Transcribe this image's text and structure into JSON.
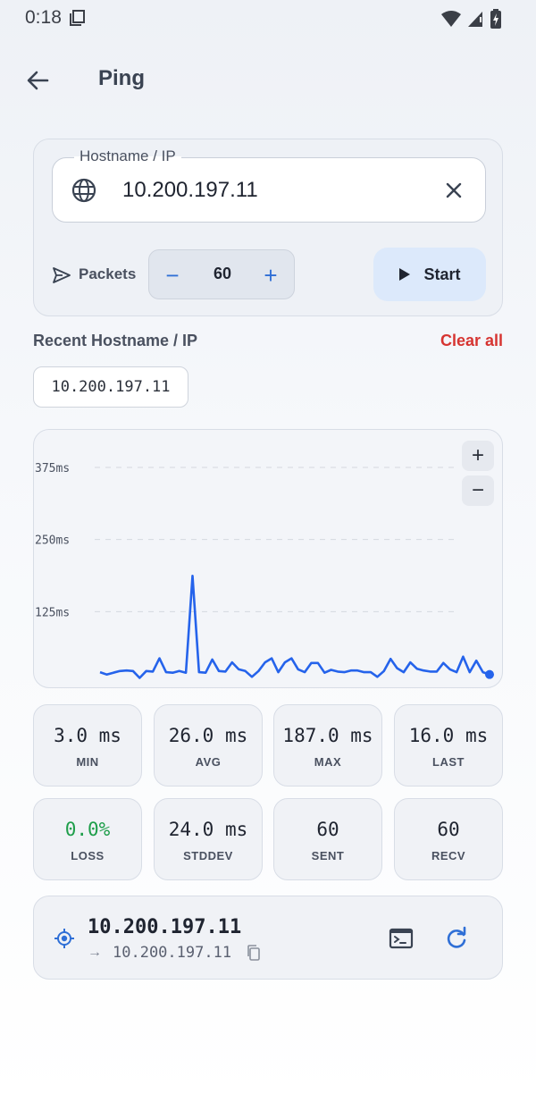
{
  "status_bar": {
    "time": "0:18"
  },
  "app_bar": {
    "title": "Ping"
  },
  "input": {
    "label": "Hostname / IP",
    "value": "10.200.197.11",
    "packets_label": "Packets",
    "packets_value": "60",
    "minus": "−",
    "plus": "+",
    "start_label": "Start"
  },
  "recent": {
    "title": "Recent Hostname / IP",
    "clear_all": "Clear all",
    "items": [
      "10.200.197.11"
    ]
  },
  "chart_data": {
    "type": "line",
    "y_tick_labels": [
      "375ms",
      "250ms",
      "125ms"
    ],
    "y_ticks": [
      375,
      250,
      125
    ],
    "ylim": [
      0,
      440
    ],
    "grid": "horizontal dashed",
    "x_range": [
      1,
      60
    ],
    "series": [
      {
        "color": "#2563eb",
        "values": [
          20,
          16,
          19,
          22,
          23,
          22,
          10,
          22,
          21,
          44,
          20,
          19,
          22,
          19,
          187,
          20,
          19,
          42,
          22,
          21,
          37,
          25,
          22,
          12,
          22,
          37,
          44,
          20,
          37,
          44,
          25,
          20,
          36,
          36,
          19,
          24,
          21,
          20,
          23,
          23,
          20,
          20,
          12,
          22,
          43,
          27,
          20,
          37,
          26,
          23,
          21,
          21,
          36,
          25,
          20,
          47,
          20,
          40,
          20,
          16
        ]
      }
    ]
  },
  "zoom": {
    "in": "+",
    "out": "−"
  },
  "stats": [
    {
      "value": "3.0 ms",
      "label": "MIN"
    },
    {
      "value": "26.0 ms",
      "label": "AVG"
    },
    {
      "value": "187.0 ms",
      "label": "MAX"
    },
    {
      "value": "16.0 ms",
      "label": "LAST"
    },
    {
      "value": "0.0%",
      "label": "LOSS",
      "color": "#1e9e4a"
    },
    {
      "value": "24.0 ms",
      "label": "STDDEV"
    },
    {
      "value": "60",
      "label": "SENT"
    },
    {
      "value": "60",
      "label": "RECV"
    }
  ],
  "result": {
    "host": "10.200.197.11",
    "arrow": "→",
    "resolved": "10.200.197.11"
  },
  "colors": {
    "accent": "#2f6fd6",
    "danger": "#d63431",
    "success": "#1e9e4a",
    "line": "#2563eb"
  }
}
